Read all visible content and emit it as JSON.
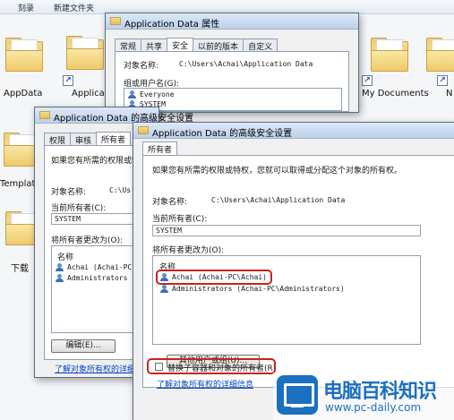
{
  "explorer": {
    "toolbar": [
      "刻录",
      "新建文件夹"
    ],
    "folders": {
      "appdata": "AppData",
      "application": "Applicati",
      "my_documents": "My Documents",
      "partial_n": "N",
      "templates": "Templat",
      "downloads": "下载"
    }
  },
  "properties_window": {
    "title": "Application Data 属性",
    "tabs": [
      "常规",
      "共享",
      "安全",
      "以前的版本",
      "自定义"
    ],
    "active_tab": "安全",
    "object_name_label": "对象名称:",
    "object_name_value": "C:\\Users\\Achai\\Application Data",
    "group_label": "组或用户名(G):",
    "users": [
      "Everyone",
      "SYSTEM"
    ]
  },
  "back_window": {
    "title": "Application Data 的高级安全设置",
    "tabs": [
      "权限",
      "审核",
      "所有者"
    ],
    "active_tab": "所有者",
    "intro": "如果您有所需的权限或特",
    "object_name_label": "对象名称:",
    "object_name_value": "C:\\Us",
    "current_owner_label": "当前所有者(C):",
    "current_owner_value": "SYSTEM",
    "change_owner_label": "将所有者更改为(O):",
    "list_header": "名称",
    "list_rows": [
      "Achai (Achai-PC\\",
      "Administrators (A"
    ],
    "edit_button": "编辑(E)...",
    "learn_link": "了解对象所有权的详细"
  },
  "front_window": {
    "title": "Application Data 的高级安全设置",
    "tab": "所有者",
    "intro": "如果您有所需的权限或特权，您就可以取得或分配这个对象的所有权。",
    "object_name_label": "对象名称:",
    "object_name_value": "C:\\Users\\Achai\\Application Data",
    "current_owner_label": "当前所有者(C):",
    "current_owner_value": "SYSTEM",
    "change_owner_label": "将所有者更改为(O):",
    "list_header": "名称",
    "list_rows": [
      "Achai (Achai-PC\\Achai)",
      "Administrators (Achai-PC\\Administrators)"
    ],
    "other_users_button": "其他用户或组(U)...",
    "replace_checkbox": "替换子容器和对象的所有者(R)",
    "replace_checked": false,
    "learn_link": "了解对象所有权的详细信息"
  },
  "watermark": {
    "title": "电脑百科知识",
    "url": "www.pc-daily.com"
  },
  "colors": {
    "highlight": "#c8231c",
    "titlebar": "#bcd1ea",
    "link": "#0645c8",
    "watermark": "#1c70c0"
  }
}
